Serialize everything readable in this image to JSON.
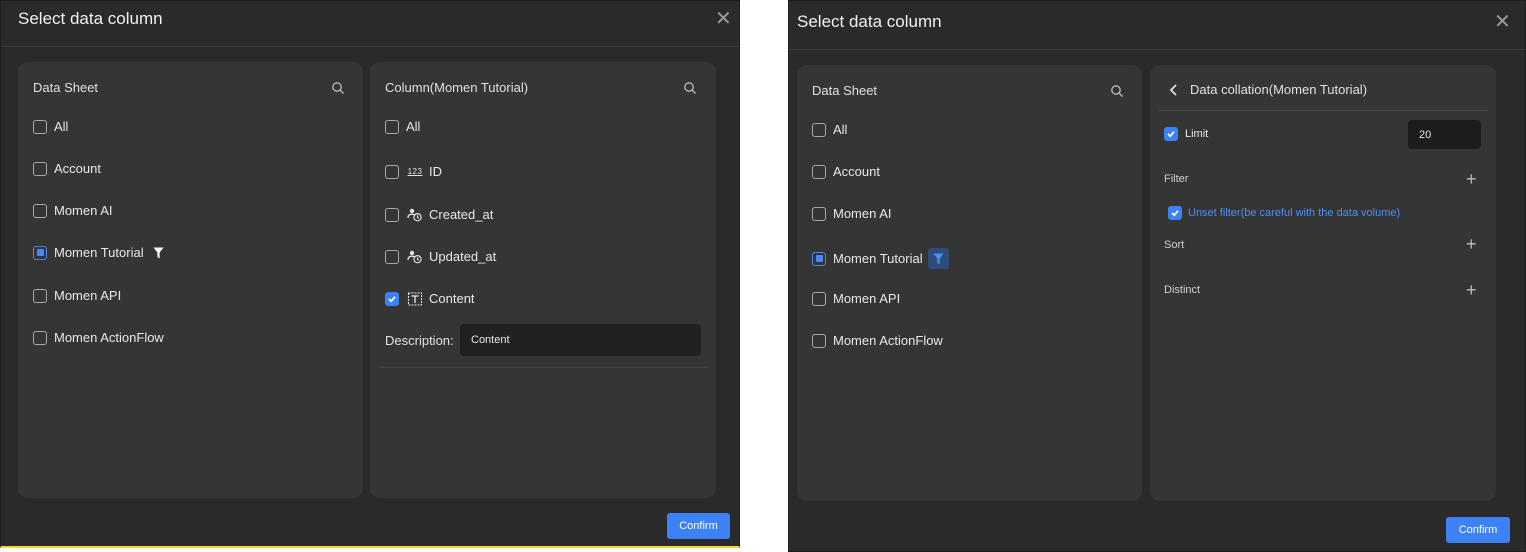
{
  "left": {
    "title": "Select data column",
    "sheet_panel": {
      "title": "Data Sheet",
      "items": [
        {
          "label": "All",
          "state": "unchecked"
        },
        {
          "label": "Account",
          "state": "unchecked"
        },
        {
          "label": "Momen AI",
          "state": "unchecked"
        },
        {
          "label": "Momen Tutorial",
          "state": "partial",
          "filter_icon": "funnel-icon"
        },
        {
          "label": "Momen API",
          "state": "unchecked"
        },
        {
          "label": "Momen ActionFlow",
          "state": "unchecked"
        }
      ]
    },
    "column_panel": {
      "title": "Column(Momen Tutorial)",
      "items": [
        {
          "label": "All",
          "icon": null,
          "state": "unchecked"
        },
        {
          "label": "ID",
          "icon": "number-type-icon",
          "state": "unchecked"
        },
        {
          "label": "Created_at",
          "icon": "datetime-type-icon",
          "state": "unchecked"
        },
        {
          "label": "Updated_at",
          "icon": "datetime-type-icon",
          "state": "unchecked"
        },
        {
          "label": "Content",
          "icon": "text-type-icon",
          "state": "checked"
        }
      ],
      "description_label": "Description:",
      "description_value": "Content",
      "number_icon_text": "123"
    },
    "confirm_label": "Confirm"
  },
  "right": {
    "title": "Select data column",
    "sheet_panel": {
      "title": "Data Sheet",
      "items": [
        {
          "label": "All",
          "state": "unchecked"
        },
        {
          "label": "Account",
          "state": "unchecked"
        },
        {
          "label": "Momen AI",
          "state": "unchecked"
        },
        {
          "label": "Momen Tutorial",
          "state": "partial",
          "filter_icon": "funnel-icon"
        },
        {
          "label": "Momen API",
          "state": "unchecked"
        },
        {
          "label": "Momen ActionFlow",
          "state": "unchecked"
        }
      ]
    },
    "collation_panel": {
      "title": "Data collation(Momen Tutorial)",
      "limit_label": "Limit",
      "limit_checked": true,
      "limit_value": "20",
      "filter_label": "Filter",
      "unset_filter_label": "Unset filter(be careful with the data volume)",
      "unset_filter_checked": true,
      "sort_label": "Sort",
      "distinct_label": "Distinct"
    },
    "confirm_label": "Confirm"
  },
  "colors": {
    "accent": "#3c82f6",
    "dialog_bg": "#2a2a2a",
    "panel_bg": "#353535",
    "link_blue": "#4d8ef5"
  }
}
